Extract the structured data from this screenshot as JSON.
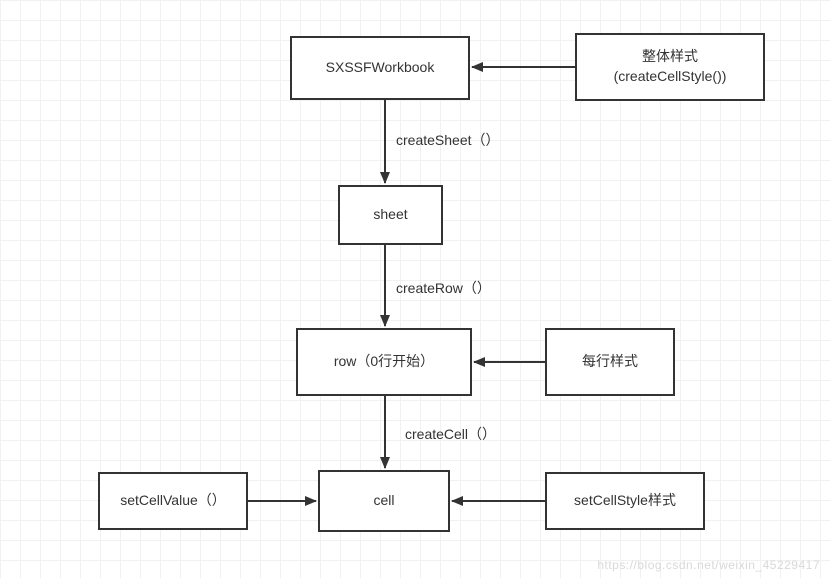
{
  "nodes": {
    "workbook": {
      "label_line1": "SXSSFWorkbook"
    },
    "style_all": {
      "label_line1": "整体样式",
      "label_line2": "(createCellStyle())"
    },
    "sheet": {
      "label_line1": "sheet"
    },
    "row": {
      "label_line1": "row（0行开始）"
    },
    "row_style": {
      "label_line1": "每行样式"
    },
    "cell": {
      "label_line1": "cell"
    },
    "set_value": {
      "label_line1": "setCellValue（）"
    },
    "cell_style": {
      "label_line1": "setCellStyle样式"
    }
  },
  "edges": {
    "createSheet": "createSheet（）",
    "createRow": "createRow（）",
    "createCell": "createCell（）"
  },
  "watermark": "https://blog.csdn.net/weixin_45229417"
}
